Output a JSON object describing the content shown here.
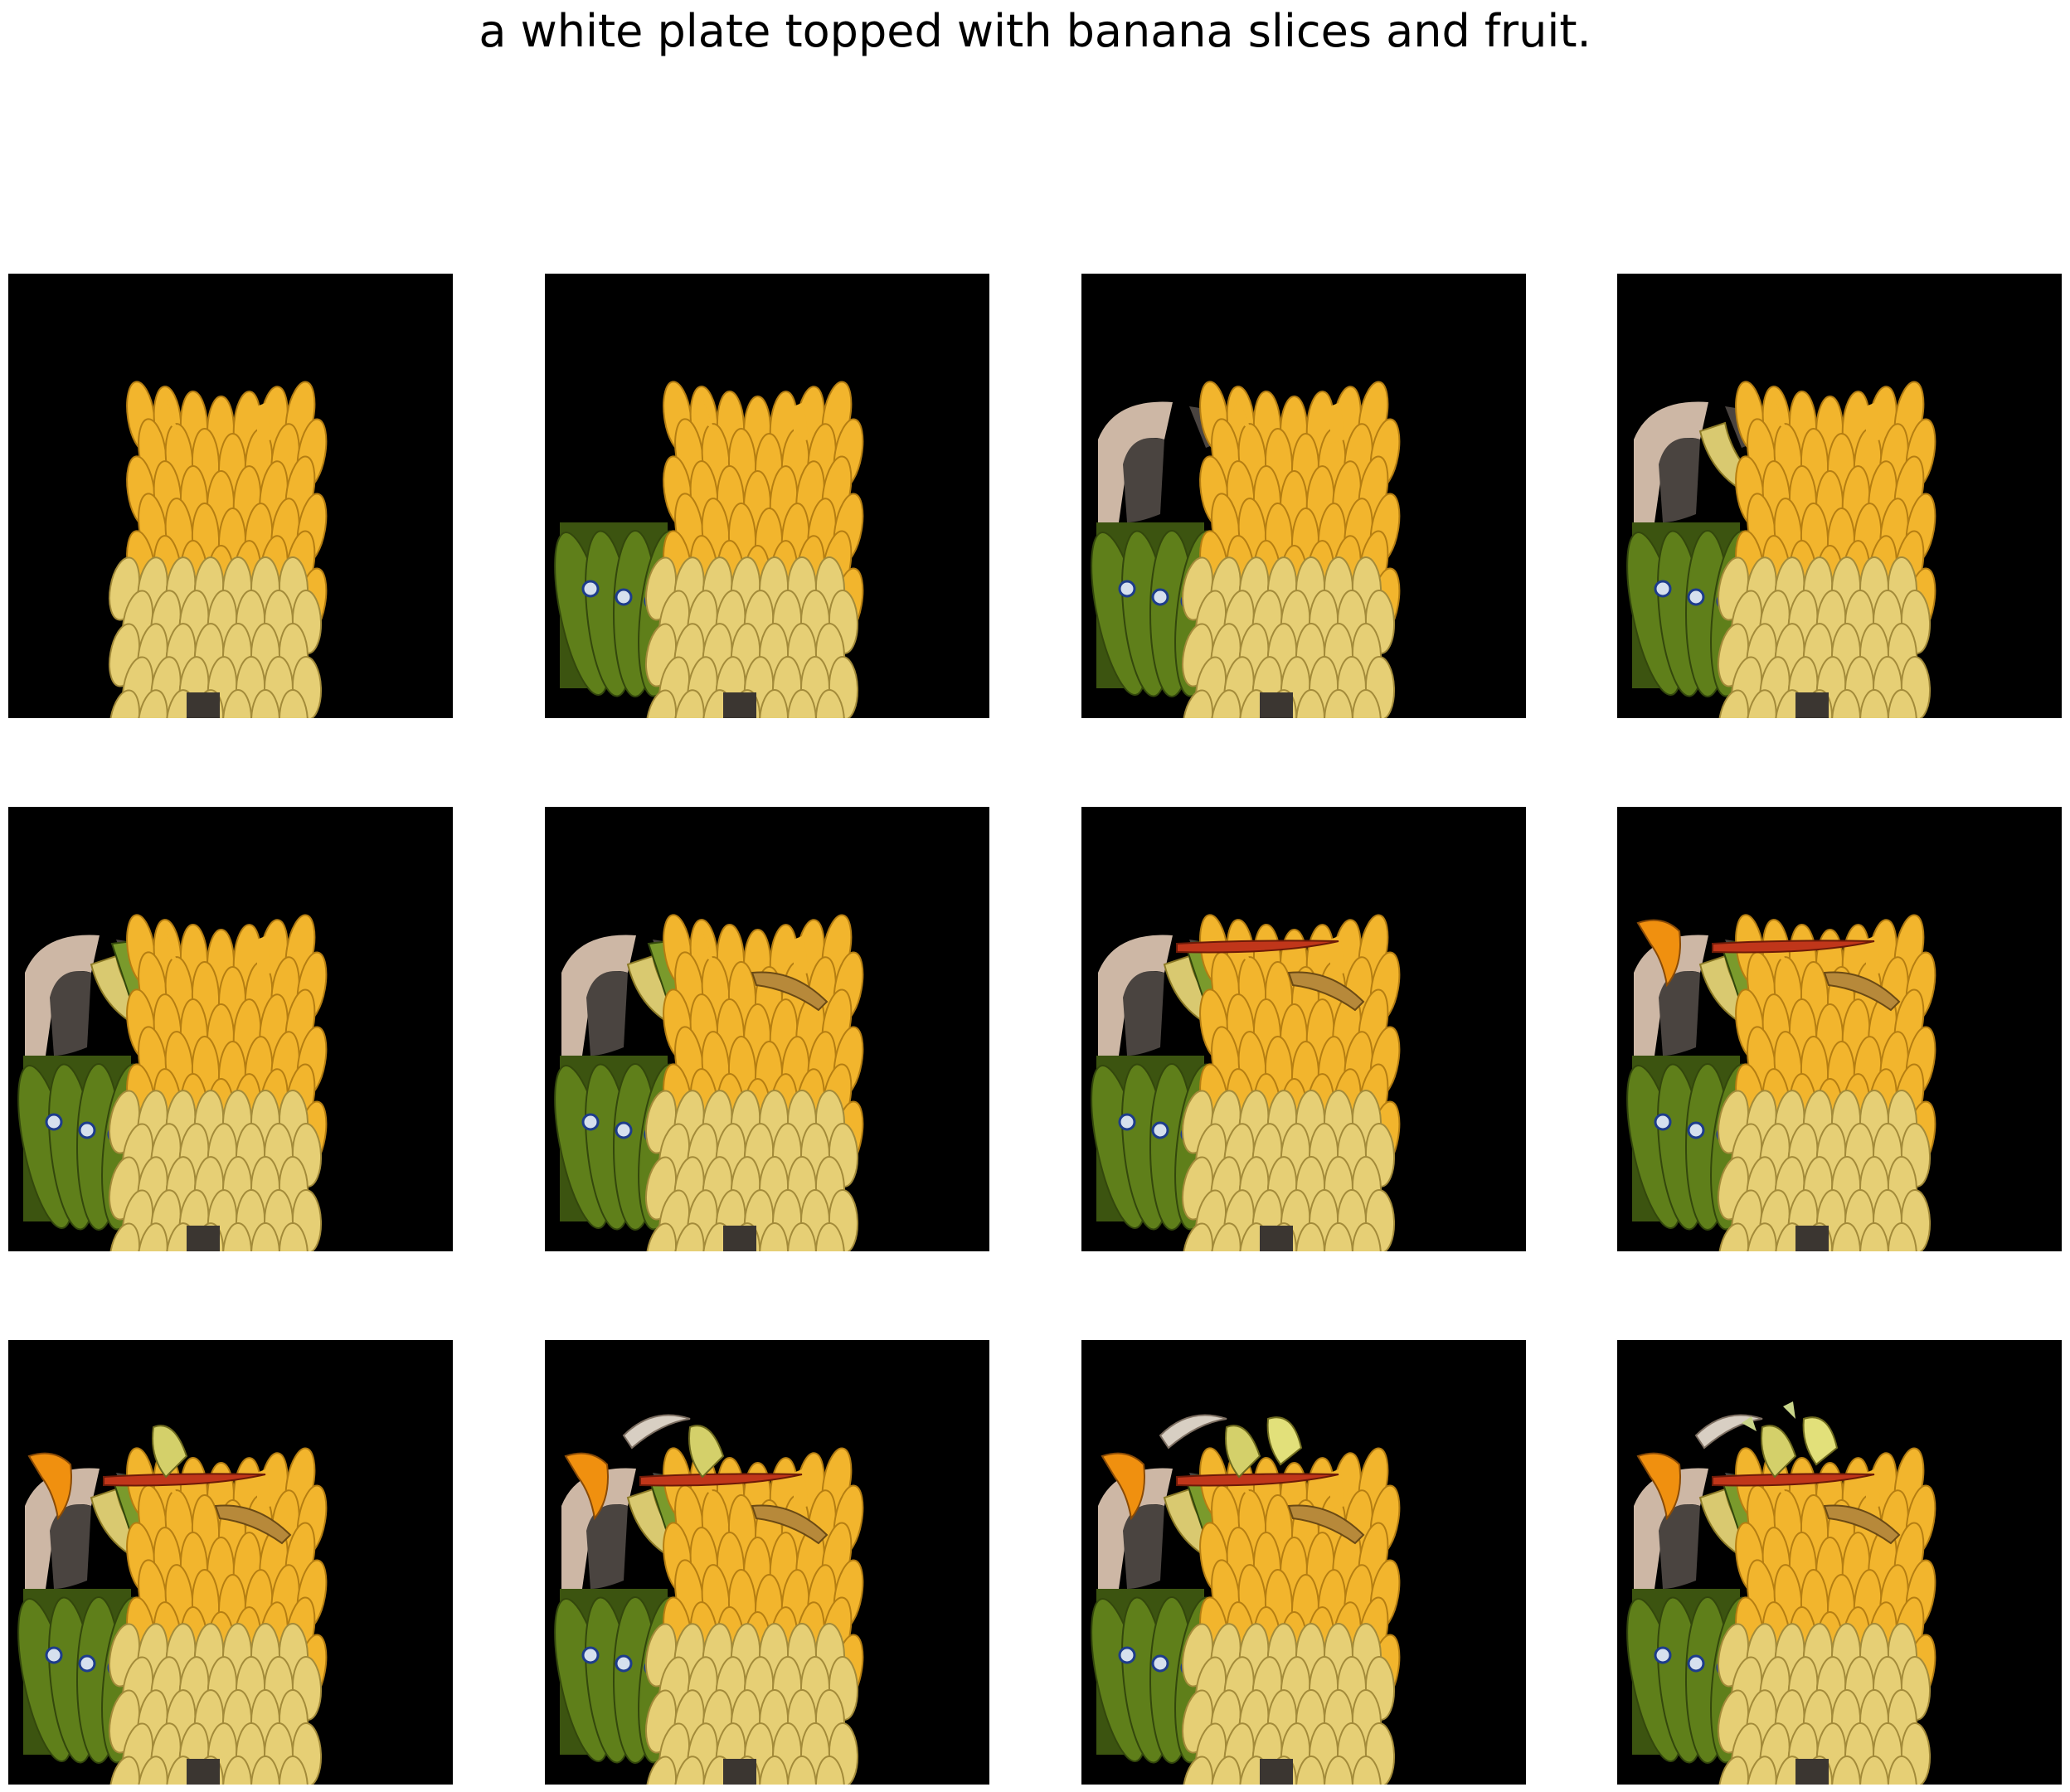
{
  "caption": "a white plate topped with banana slices and fruit.",
  "grid": {
    "rows": 3,
    "columns": 4
  },
  "colors": {
    "background": "#000000",
    "ripe_banana": "#f2b52d",
    "pale_banana": "#e6cf75",
    "green_banana": "#5f7f1a",
    "red_banana": "#c0361a",
    "orange_banana": "#f0900f",
    "dark_peel": "#4a4440",
    "pale_peel": "#cdb7a5"
  },
  "frames": [
    {
      "step": 1,
      "layers": [
        "ripe-bunch"
      ]
    },
    {
      "step": 2,
      "layers": [
        "ripe-bunch",
        "green-bunch"
      ]
    },
    {
      "step": 3,
      "layers": [
        "ripe-bunch",
        "green-bunch",
        "dark-peel"
      ]
    },
    {
      "step": 4,
      "layers": [
        "ripe-bunch",
        "green-bunch",
        "dark-peel",
        "peeled-banana"
      ]
    },
    {
      "step": 5,
      "layers": [
        "ripe-bunch",
        "green-bunch",
        "dark-peel",
        "peeled-banana",
        "green-stalk"
      ]
    },
    {
      "step": 6,
      "layers": [
        "ripe-bunch",
        "green-bunch",
        "dark-peel",
        "peeled-banana",
        "green-stalk",
        "brown-banana"
      ]
    },
    {
      "step": 7,
      "layers": [
        "ripe-bunch",
        "green-bunch",
        "dark-peel",
        "peeled-banana",
        "green-stalk",
        "brown-banana",
        "red-banana"
      ]
    },
    {
      "step": 8,
      "layers": [
        "ripe-bunch",
        "green-bunch",
        "dark-peel",
        "peeled-banana",
        "green-stalk",
        "brown-banana",
        "red-banana",
        "orange-banana"
      ]
    },
    {
      "step": 9,
      "layers": [
        "ripe-bunch",
        "green-bunch",
        "dark-peel",
        "peeled-banana",
        "green-stalk",
        "brown-banana",
        "red-banana",
        "orange-banana",
        "yellow-peel"
      ]
    },
    {
      "step": 10,
      "layers": [
        "ripe-bunch",
        "green-bunch",
        "dark-peel",
        "peeled-banana",
        "green-stalk",
        "brown-banana",
        "red-banana",
        "orange-banana",
        "yellow-peel",
        "pale-arc"
      ]
    },
    {
      "step": 11,
      "layers": [
        "ripe-bunch",
        "green-bunch",
        "dark-peel",
        "peeled-banana",
        "green-stalk",
        "brown-banana",
        "red-banana",
        "orange-banana",
        "yellow-peel",
        "pale-arc",
        "split-peel"
      ]
    },
    {
      "step": 12,
      "layers": [
        "ripe-bunch",
        "green-bunch",
        "dark-peel",
        "peeled-banana",
        "green-stalk",
        "brown-banana",
        "red-banana",
        "orange-banana",
        "yellow-peel",
        "pale-arc",
        "split-peel",
        "leaf-tips"
      ]
    }
  ]
}
